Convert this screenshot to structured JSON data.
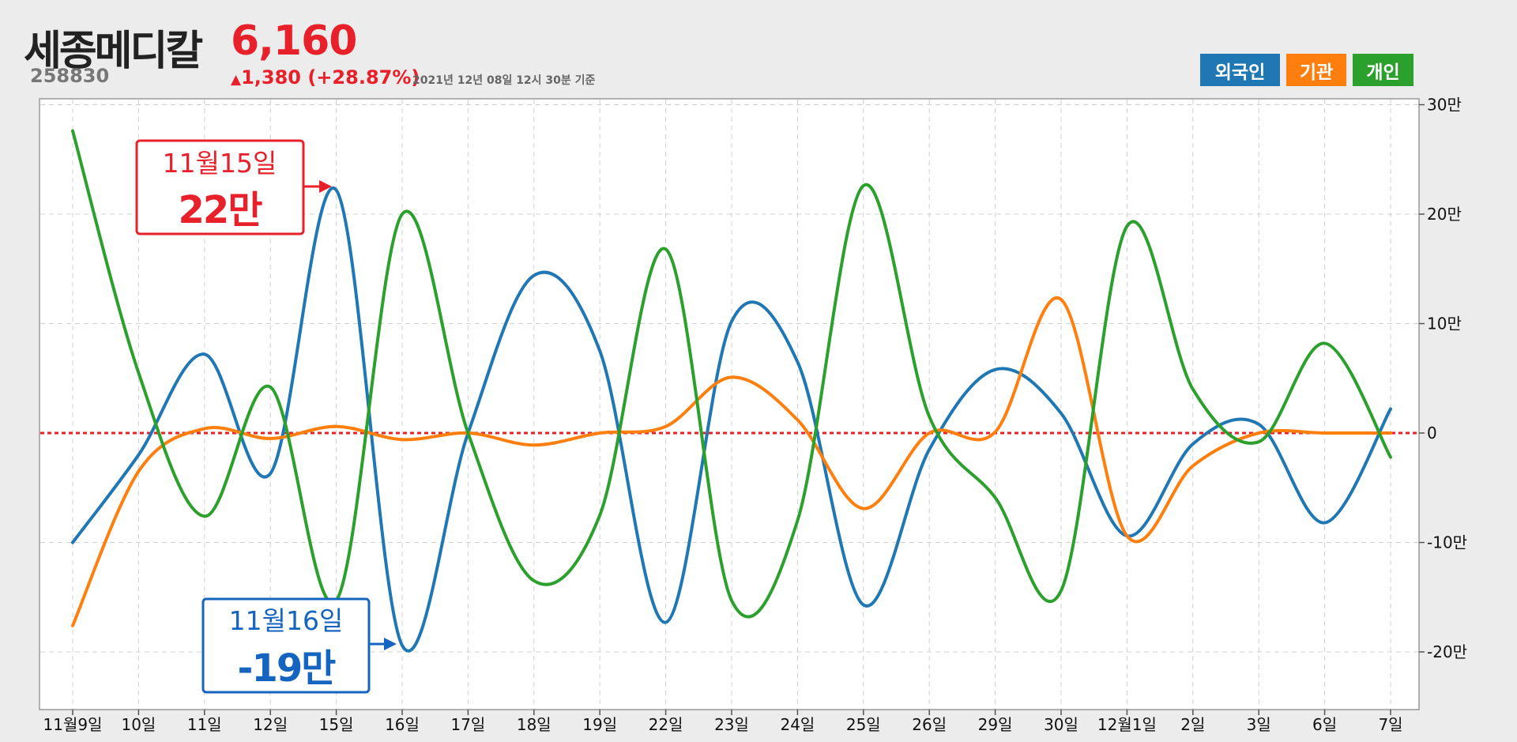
{
  "header": {
    "name": "세종메디칼",
    "code": "258830",
    "price": "6,160",
    "change_arrow": "▲",
    "change": "1,380 (+28.87%)",
    "asof": "2021년 12년 08일 12시 30분 기준"
  },
  "legend": [
    {
      "label": "외국인",
      "color": "#1f77b4"
    },
    {
      "label": "기관",
      "color": "#ff7f0e"
    },
    {
      "label": "개인",
      "color": "#2ca02c"
    }
  ],
  "chart_data": {
    "type": "line",
    "categories": [
      "11월9일",
      "10일",
      "11일",
      "12일",
      "15일",
      "16일",
      "17일",
      "18일",
      "19일",
      "22일",
      "23일",
      "24일",
      "25일",
      "26일",
      "29일",
      "30일",
      "12월1일",
      "2일",
      "3일",
      "6일",
      "7일"
    ],
    "series": [
      {
        "name": "외국인",
        "color": "#1f77b4",
        "values": [
          -10,
          -2,
          7.2,
          -3.7,
          22.2,
          -19.4,
          0,
          14.4,
          7.5,
          -17.3,
          10.2,
          6.5,
          -15.7,
          -1.5,
          5.8,
          1.8,
          -9.4,
          -1,
          0.8,
          -8.2,
          2.2
        ]
      },
      {
        "name": "기관",
        "color": "#ff7f0e",
        "values": [
          -17.6,
          -3.5,
          0.4,
          -0.5,
          0.6,
          -0.6,
          0,
          -1.1,
          0,
          0.6,
          5.1,
          1.2,
          -6.9,
          0,
          0.1,
          12.2,
          -9.4,
          -3,
          0,
          0,
          0
        ]
      },
      {
        "name": "개인",
        "color": "#2ca02c",
        "values": [
          27.6,
          5.5,
          -7.6,
          4.2,
          -15.3,
          20,
          0,
          -13.5,
          -7.5,
          16.8,
          -15.3,
          -8,
          22.6,
          1.5,
          -5.9,
          -14.4,
          18.9,
          4,
          -0.8,
          8.2,
          -2.2
        ]
      }
    ],
    "y_ticks": [
      {
        "value": 30,
        "label": "30만"
      },
      {
        "value": 20,
        "label": "20만"
      },
      {
        "value": 10,
        "label": "10만"
      },
      {
        "value": 0,
        "label": "0"
      },
      {
        "value": -10,
        "label": "-10만"
      },
      {
        "value": -20,
        "label": "-20만"
      }
    ],
    "ylim": [
      -25,
      30.5
    ],
    "grid": true,
    "annotations": [
      {
        "date": "11월15일",
        "value": "22만",
        "color": "#e8202a",
        "target_index": 4,
        "target_value": 22.2
      },
      {
        "date": "11월16일",
        "value": "-19만",
        "color": "#1565c0",
        "target_index": 5,
        "target_value": -19.4
      }
    ]
  }
}
